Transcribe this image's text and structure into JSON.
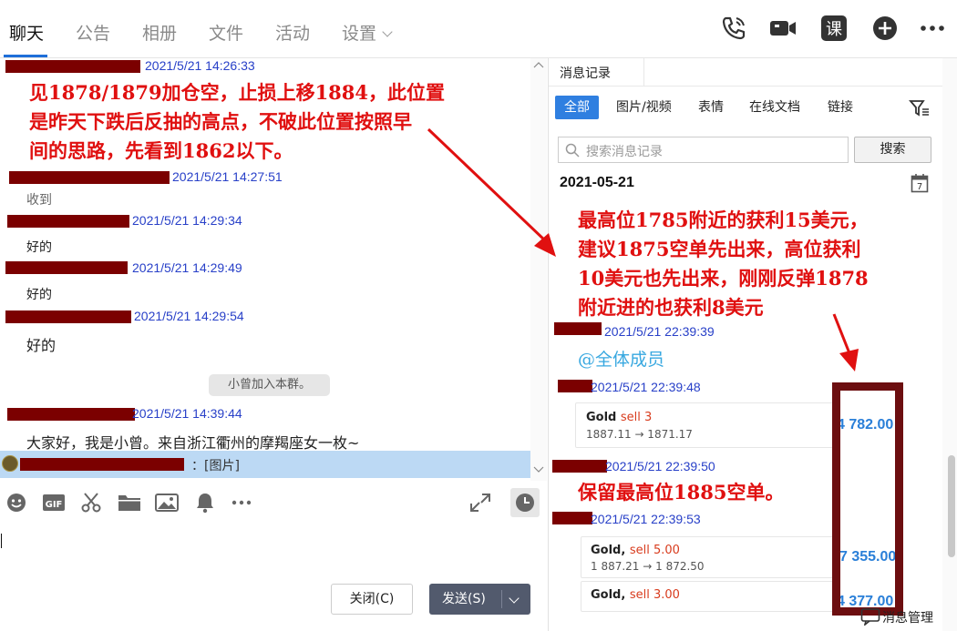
{
  "tabs": [
    {
      "label": "聊天",
      "active": true
    },
    {
      "label": "公告",
      "active": false
    },
    {
      "label": "相册",
      "active": false
    },
    {
      "label": "文件",
      "active": false
    },
    {
      "label": "活动",
      "active": false
    },
    {
      "label": "设置",
      "active": false
    }
  ],
  "top_icons": [
    "phone-icon",
    "video-icon",
    "class-icon",
    "plus-circle-icon",
    "more-icon"
  ],
  "top_icon_labels": {
    "class": "课"
  },
  "chat": {
    "messages": [
      {
        "time": "2021/5/21 14:26:33",
        "text": ""
      },
      {
        "time": "2021/5/21 14:27:51",
        "text": "收到"
      },
      {
        "time": "2021/5/21 14:29:34",
        "text": "好的"
      },
      {
        "time": "2021/5/21 14:29:49",
        "text": "好的"
      },
      {
        "time": "2021/5/21 14:29:54",
        "text": "好的"
      },
      {
        "time": "2021/5/21 14:39:44",
        "text": "大家好，我是小曾。来自浙江衢州的摩羯座女一枚~"
      }
    ],
    "system_notice": "小曾加入本群。",
    "highlighted_preview": "：[图片]",
    "annotation": {
      "line1": "见1878/1879加仓空，止损上移1884，此位置",
      "line2": "是昨天下跌后反抽的高点，不破此位置按照早",
      "line3": "间的思路，先看到1862以下。"
    }
  },
  "composer": {
    "toolbar_icons": [
      "emoji-icon",
      "gif-icon",
      "scissors-icon",
      "folder-icon",
      "image-icon",
      "bell-icon",
      "more-icon",
      "expand-icon",
      "history-clock-icon"
    ],
    "gif_label": "GIF",
    "close_label": "关闭(C)",
    "send_label": "发送(S)"
  },
  "history": {
    "tab_label": "消息记录",
    "filters": [
      "全部",
      "图片/视频",
      "表情",
      "在线文档",
      "链接"
    ],
    "active_filter": "全部",
    "search_placeholder": "搜索消息记录",
    "search_button": "搜索",
    "date": "2021-05-21",
    "calendar_day": "7",
    "annotation": {
      "line1": "最高位1785附近的获利15美元，",
      "line2": "建议1875空单先出来，高位获利",
      "line3": "10美元也先出来，刚刚反弹1878",
      "line4": "附近进的也获利8美元",
      "keep": "保留最高位1885空单。"
    },
    "entries": [
      {
        "time": "2021/5/21 22:39:39",
        "text": "@全体成员"
      },
      {
        "time": "2021/5/21 22:39:48"
      },
      {
        "time": "2021/5/21 22:39:50"
      },
      {
        "time": "2021/5/21 22:39:53"
      }
    ],
    "trade_cards": [
      {
        "symbol": "Gold",
        "side": "sell 3",
        "prices": "1887.11 → 1871.17",
        "amount": "4 782.00"
      },
      {
        "symbol": "Gold,",
        "side": "sell 5.00",
        "prices": "1 887.21 → 1 872.50",
        "amount": "7 355.00"
      },
      {
        "symbol": "Gold,",
        "side": "sell 3.00",
        "prices": "",
        "amount": "4 377.00"
      }
    ],
    "footer_label": "消息管理"
  },
  "colors": {
    "accent": "#2f7fe0",
    "timestamp": "#2840c8",
    "annotation_red": "#e01010",
    "redaction": "#7b0000",
    "frame": "#6c0e10"
  }
}
